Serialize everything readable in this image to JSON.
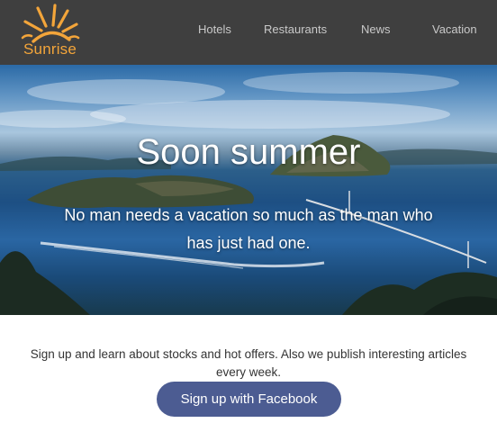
{
  "brand": {
    "name": "Sunrise",
    "color": "#f3a53a"
  },
  "nav": {
    "items": [
      {
        "label": "Hotels"
      },
      {
        "label": "Restaurants"
      },
      {
        "label": "News"
      },
      {
        "label": "Vacation"
      }
    ],
    "background": "#3f3f3f",
    "text_color": "#c9c9c9"
  },
  "hero": {
    "title": "Soon summer",
    "subtitle": "No man needs a vacation so much as the man who has just had one.",
    "image": "coastal-islands-photo"
  },
  "signup": {
    "text": "Sign up and learn about stocks and hot offers. Also we publish interesting articles every week.",
    "button_label": "Sign up with Facebook",
    "button_color": "#4c5c92"
  }
}
